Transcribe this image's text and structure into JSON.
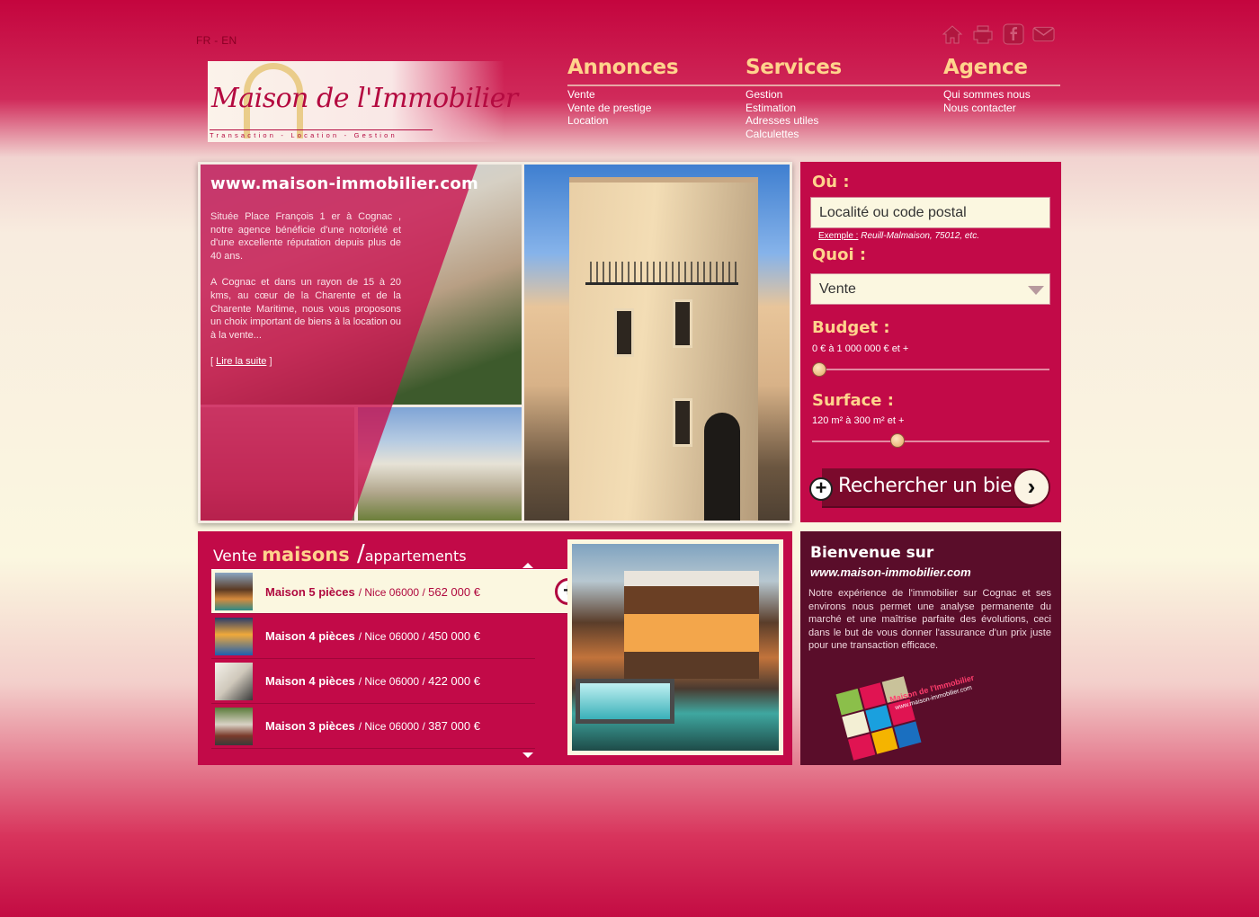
{
  "lang": {
    "fr": "FR",
    "sep": " - ",
    "en": "EN"
  },
  "top_icons": [
    "home-icon",
    "print-icon",
    "facebook-icon",
    "email-icon"
  ],
  "logo": {
    "brand": "Maison de l'Immobilier",
    "tagline": "Transaction - Location - Gestion"
  },
  "nav": [
    {
      "title": "Annonces",
      "items": [
        "Vente",
        "Vente de prestige",
        "Location"
      ]
    },
    {
      "title": "Services",
      "items": [
        "Gestion",
        "Estimation",
        "Adresses utiles",
        "Calculettes"
      ]
    },
    {
      "title": "Agence",
      "items": [
        "Qui sommes nous",
        "Nous contacter"
      ]
    }
  ],
  "hero": {
    "url": "www.maison-immobilier.com",
    "p1": "Située Place François 1 er à Cognac , notre agence bénéficie d'une notoriété et d'une excellente réputation depuis plus de 40 ans.",
    "p2": "A Cognac et dans un rayon de 15 à 20 kms, au cœur de la Charente et de la Charente Maritime, nous vous proposons un choix important de biens à la location ou à la vente...",
    "more_open": "[ ",
    "more": "Lire la suite",
    "more_close": " ]"
  },
  "search": {
    "where_label": "Où :",
    "where_placeholder": "Localité ou code postal",
    "example_label": "Exemple :",
    "example_text": " Reuill-Malmaison, 75012, etc.",
    "what_label": "Quoi :",
    "what_value": "Vente",
    "budget_label": "Budget :",
    "budget_range": "0 € à 1 000 000 € et +",
    "budget_level": 0,
    "surface_label": "Surface :",
    "surface_range": "120 m² à 300 m² et +",
    "surface_level": 0.35,
    "button": "Rechercher un bien"
  },
  "listing": {
    "title_a": "Vente ",
    "title_b": "maisons",
    "title_c": " /",
    "title_d": "appartements",
    "rows": [
      {
        "title": "Maison 5 pièces",
        "sep": " / ",
        "place": "Nice 06000",
        "sep2": " / ",
        "price": "562 000 €"
      },
      {
        "title": "Maison 4 pièces",
        "sep": " / ",
        "place": "Nice 06000",
        "sep2": " / ",
        "price": "450 000 €"
      },
      {
        "title": "Maison 4 pièces",
        "sep": " / ",
        "place": "Nice 06000",
        "sep2": " / ",
        "price": "422 000 €"
      },
      {
        "title": "Maison 3 pièces",
        "sep": " / ",
        "place": "Nice 06000",
        "sep2": " / ",
        "price": "387 000 €"
      }
    ]
  },
  "welcome": {
    "title": "Bienvenue sur",
    "url": "www.maison-immobilier.com",
    "text": "Notre expérience de l'immobilier sur Cognac et ses environs nous permet une analyse permanente du marché et une maîtrise parfaite des évolutions, ceci dans le but de vous donner l'assurance d'un prix juste pour une transaction efficace.",
    "logo_brand": "Maison de l'Immobilier",
    "logo_url": "www.maison-immobilier.com"
  },
  "colors": {
    "accent": "#c20a48",
    "gold": "#ffd38c",
    "cream": "#fbf7e0",
    "dark": "#5a0d2a"
  }
}
